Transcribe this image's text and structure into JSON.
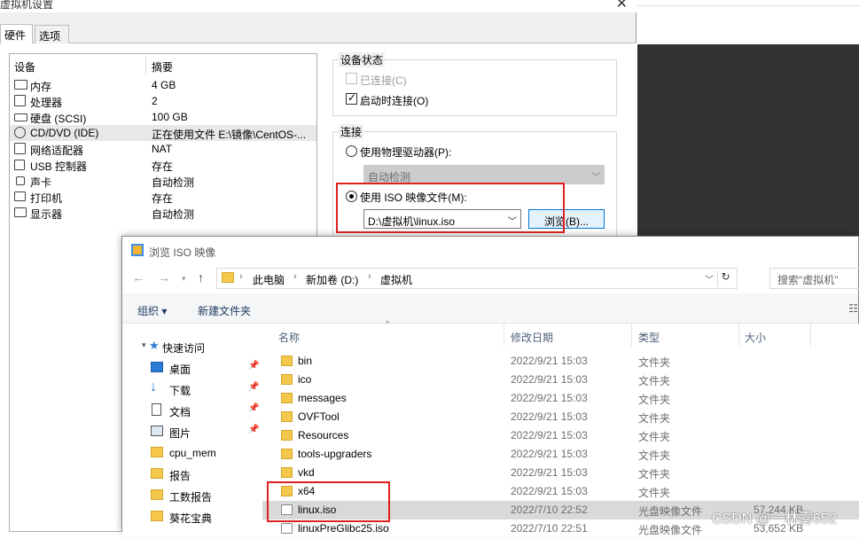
{
  "vm_settings": {
    "title": "虚拟机设置",
    "tabs": [
      "硬件",
      "选项"
    ],
    "device_list": {
      "header_device": "设备",
      "header_summary": "摘要",
      "devices": [
        {
          "name": "内存",
          "summary": "4 GB",
          "icon": "memory-icon"
        },
        {
          "name": "处理器",
          "summary": "2",
          "icon": "cpu-icon"
        },
        {
          "name": "硬盘 (SCSI)",
          "summary": "100 GB",
          "icon": "hard-disk-icon"
        },
        {
          "name": "CD/DVD (IDE)",
          "summary": "正在使用文件 E:\\镜像\\CentOS-...",
          "icon": "cd-dvd-icon"
        },
        {
          "name": "网络适配器",
          "summary": "NAT",
          "icon": "network-adapter-icon"
        },
        {
          "name": "USB 控制器",
          "summary": "存在",
          "icon": "usb-icon"
        },
        {
          "name": "声卡",
          "summary": "自动检测",
          "icon": "sound-card-icon"
        },
        {
          "name": "打印机",
          "summary": "存在",
          "icon": "printer-icon"
        },
        {
          "name": "显示器",
          "summary": "自动检测",
          "icon": "display-icon"
        }
      ]
    },
    "device_status": {
      "title": "设备状态",
      "connected_label": "已连接(C)",
      "connect_at_power_on_label": "启动时连接(O)"
    },
    "connection": {
      "title": "连接",
      "physical_drive_label": "使用物理驱动器(P):",
      "physical_drive_value": "自动检测",
      "iso_label": "使用 ISO 映像文件(M):",
      "iso_path": "D:\\虚拟机\\linux.iso",
      "browse_label": "浏览(B)..."
    }
  },
  "iso_dialog": {
    "title": "浏览 ISO 映像",
    "breadcrumb": [
      "此电脑",
      "新加卷 (D:)",
      "虚拟机"
    ],
    "search_placeholder": "搜索\"虚拟机\"",
    "organize_label": "组织 ▾",
    "new_folder_label": "新建文件夹",
    "nav": [
      {
        "label": "快速访问",
        "icon": "star-icon",
        "pinned": false
      },
      {
        "label": "桌面",
        "icon": "desktop-icon",
        "pinned": true
      },
      {
        "label": "下载",
        "icon": "download-icon",
        "pinned": true
      },
      {
        "label": "文档",
        "icon": "documents-icon",
        "pinned": true
      },
      {
        "label": "图片",
        "icon": "pictures-icon",
        "pinned": true
      },
      {
        "label": "cpu_mem",
        "icon": "folder-icon",
        "pinned": false
      },
      {
        "label": "报告",
        "icon": "folder-icon",
        "pinned": false
      },
      {
        "label": "工数报告",
        "icon": "folder-icon",
        "pinned": false
      },
      {
        "label": "葵花宝典",
        "icon": "folder-icon",
        "pinned": false
      }
    ],
    "columns": {
      "name": "名称",
      "date": "修改日期",
      "type": "类型",
      "size": "大小"
    },
    "files": [
      {
        "name": "bin",
        "date": "2022/9/21 15:03",
        "type": "文件夹",
        "size": "",
        "kind": "folder"
      },
      {
        "name": "ico",
        "date": "2022/9/21 15:03",
        "type": "文件夹",
        "size": "",
        "kind": "folder"
      },
      {
        "name": "messages",
        "date": "2022/9/21 15:03",
        "type": "文件夹",
        "size": "",
        "kind": "folder"
      },
      {
        "name": "OVFTool",
        "date": "2022/9/21 15:03",
        "type": "文件夹",
        "size": "",
        "kind": "folder"
      },
      {
        "name": "Resources",
        "date": "2022/9/21 15:03",
        "type": "文件夹",
        "size": "",
        "kind": "folder"
      },
      {
        "name": "tools-upgraders",
        "date": "2022/9/21 15:03",
        "type": "文件夹",
        "size": "",
        "kind": "folder"
      },
      {
        "name": "vkd",
        "date": "2022/9/21 15:03",
        "type": "文件夹",
        "size": "",
        "kind": "folder"
      },
      {
        "name": "x64",
        "date": "2022/9/21 15:03",
        "type": "文件夹",
        "size": "",
        "kind": "folder"
      },
      {
        "name": "linux.iso",
        "date": "2022/7/10 22:52",
        "type": "光盘映像文件",
        "size": "57,244 KB",
        "kind": "file"
      },
      {
        "name": "linuxPreGlibc25.iso",
        "date": "2022/7/10 22:51",
        "type": "光盘映像文件",
        "size": "53,652 KB",
        "kind": "file"
      }
    ]
  },
  "watermark": "CSDN @一林雾652",
  "colors": {
    "highlight_box": "#e02020",
    "selection": "#d9d9d9",
    "accent": "#0078d7"
  }
}
